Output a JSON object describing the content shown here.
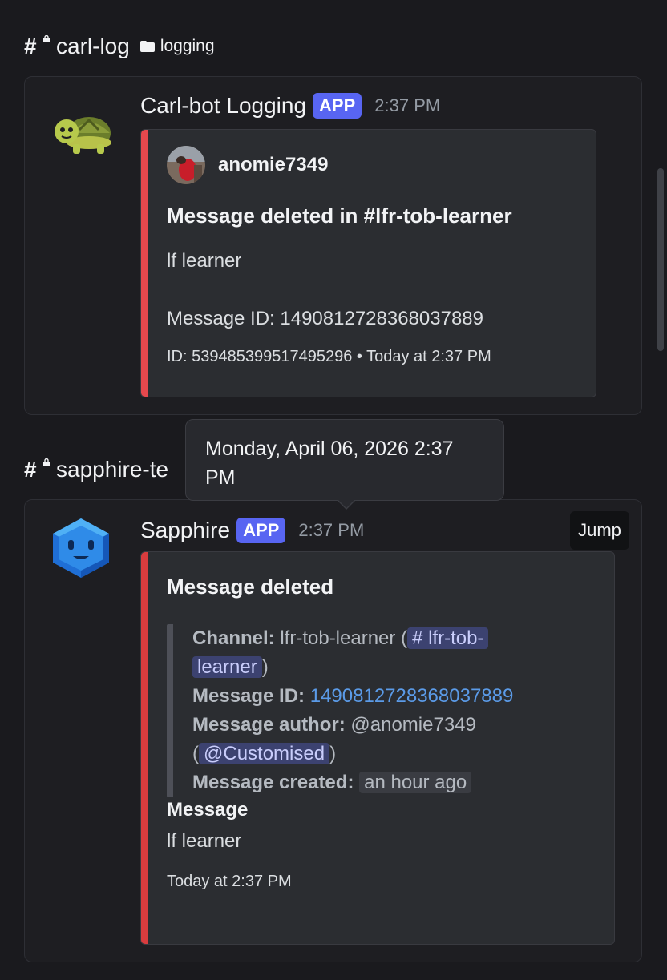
{
  "channels": [
    {
      "name": "carl-log",
      "category": "logging"
    },
    {
      "name": "sapphire-te"
    }
  ],
  "carl_message": {
    "author": "Carl-bot Logging",
    "badge": "APP",
    "time": "2:37 PM",
    "embed": {
      "author_name": "anomie7349",
      "title": "Message deleted in #lfr-tob-learner",
      "content": "lf learner",
      "message_id_line": "Message ID: 1490812728368037889",
      "footer": "ID: 539485399517495296 • Today at 2:37 PM",
      "color": "#e5484d"
    }
  },
  "tooltip": {
    "line1": "Monday, April 06, 2026 2:37",
    "line2": "PM"
  },
  "sapphire_message": {
    "author": "Sapphire",
    "badge": "APP",
    "time": "2:37 PM",
    "jump_label": "Jump",
    "embed": {
      "title": "Message deleted",
      "channel_label": "Channel:",
      "channel_value": "lfr-tob-learner (",
      "channel_mention_1": "# lfr-tob-",
      "channel_mention_2": "learner",
      "close_paren": ")",
      "message_id_label": "Message ID:",
      "message_id_value": "1490812728368037889",
      "author_label": "Message author:",
      "author_value": "@anomie7349",
      "open_paren": "(",
      "role_mention": "@Customised",
      "created_label": "Message created:",
      "created_value": "an hour ago",
      "message_label": "Message",
      "message_content": "lf learner",
      "footer": "Today at 2:37 PM",
      "color": "#d83c3e"
    }
  }
}
